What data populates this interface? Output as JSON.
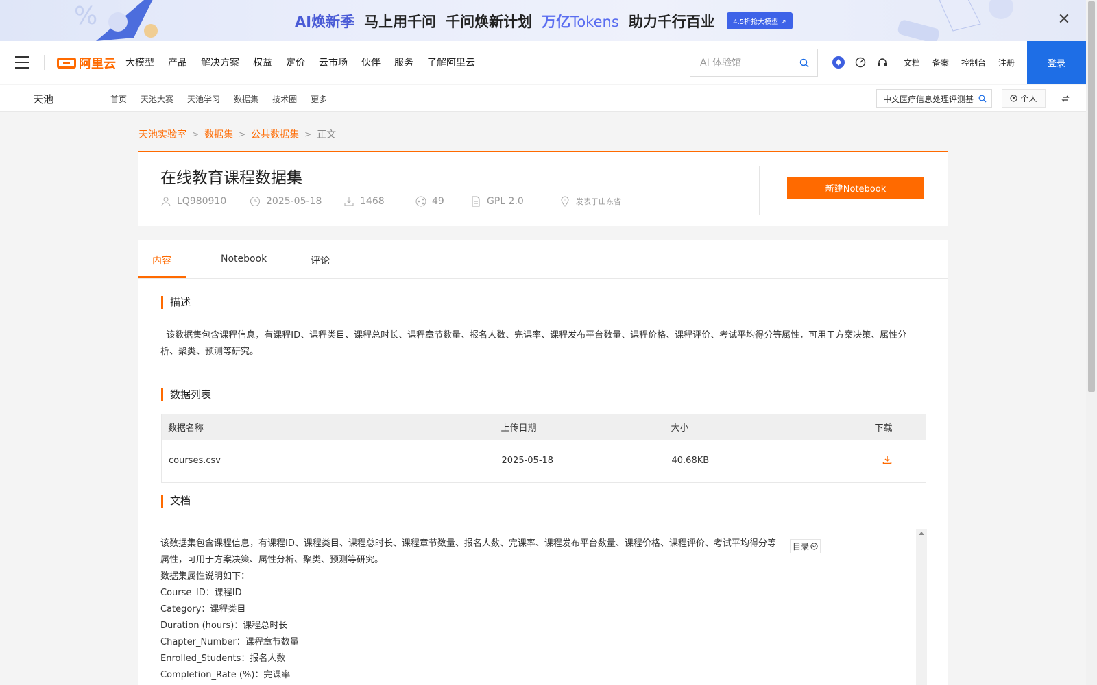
{
  "banner": {
    "ai_label": "AI焕新季",
    "slogan1": "马上用千问",
    "slogan2": "千问焕新计划",
    "tokens_prefix": "万亿",
    "tokens_word": "Tokens",
    "slogan3": "助力千行百业",
    "cta": "4.5折抢大模型 ↗",
    "close": "✕"
  },
  "topnav": {
    "logo_text": "阿里云",
    "menu": [
      "大模型",
      "产品",
      "解决方案",
      "权益",
      "定价",
      "云市场",
      "伙伴",
      "服务",
      "了解阿里云"
    ],
    "search_placeholder": "AI 体验馆",
    "links": [
      "文档",
      "备案",
      "控制台",
      "注册"
    ],
    "login": "登录"
  },
  "subnav": {
    "brand": "天池",
    "links": [
      "首页",
      "天池大赛",
      "天池学习",
      "数据集",
      "技术圈",
      "更多"
    ],
    "search_value": "中文医疗信息处理评测基",
    "personal": "个人"
  },
  "breadcrumb": [
    "天池实验室",
    "数据集",
    "公共数据集",
    "正文"
  ],
  "dataset": {
    "title": "在线教育课程数据集",
    "author": "LQ980910",
    "date": "2025-05-18",
    "downloads": "1468",
    "shares": "49",
    "license": "GPL 2.0",
    "location": "发表于山东省",
    "new_notebook": "新建Notebook"
  },
  "tabs": [
    "内容",
    "Notebook",
    "评论"
  ],
  "sections": {
    "desc_title": "描述",
    "desc_text": "该数据集包含课程信息，有课程ID、课程类目、课程总时长、课程章节数量、报名人数、完课率、课程发布平台数量、课程价格、课程评价、考试平均得分等属性，可用于方案决策、属性分析、聚类、预测等研究。",
    "list_title": "数据列表",
    "doc_title": "文档"
  },
  "table": {
    "headers": [
      "数据名称",
      "上传日期",
      "大小",
      "下载"
    ],
    "rows": [
      {
        "name": "courses.csv",
        "date": "2025-05-18",
        "size": "40.68KB"
      }
    ]
  },
  "doc": {
    "lines": [
      "该数据集包含课程信息，有课程ID、课程类目、课程总时长、课程章节数量、报名人数、完课率、课程发布平台数量、课程价格、课程评价、考试平均得分等属性，可用于方案决策、属性分析、聚类、预测等研究。",
      "数据集属性说明如下：",
      "Course_ID：课程ID",
      "Category：课程类目",
      "Duration (hours)：课程总时长",
      "Chapter_Number：课程章节数量",
      "Enrolled_Students：报名人数",
      "Completion_Rate (%)：完课率"
    ],
    "toc": "目录"
  },
  "colors": {
    "accent": "#ff6a00",
    "login_blue": "#1e6ee6"
  }
}
